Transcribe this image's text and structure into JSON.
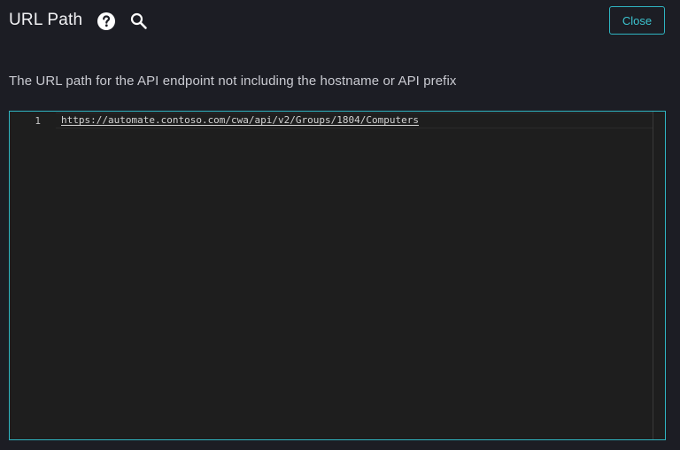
{
  "header": {
    "title": "URL Path",
    "help_icon": "question-circle-icon",
    "search_icon": "magnifier-icon",
    "close_label": "Close"
  },
  "description": "The URL path for the API endpoint not including the hostname or API prefix",
  "editor": {
    "lines": [
      {
        "number": "1",
        "text": "https://automate.contoso.com/cwa/api/v2/Groups/1804/Computers"
      }
    ]
  },
  "colors": {
    "background": "#1c1d24",
    "accent": "#2fb4c1",
    "editor_background": "#1e1e1e"
  }
}
